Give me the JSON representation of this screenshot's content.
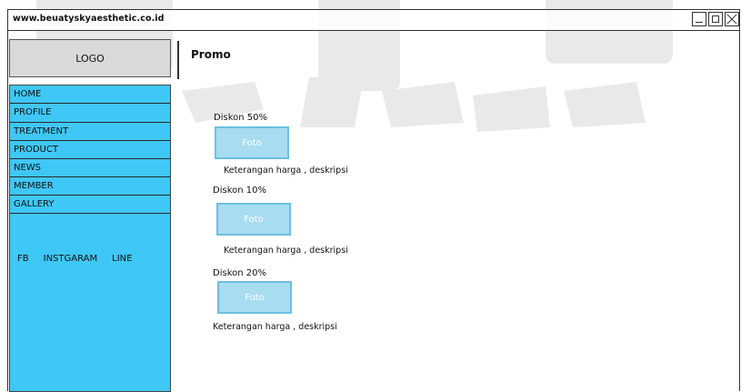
{
  "window": {
    "url": "www.beuatyskyaesthetic.co.id",
    "controls": [
      "minimize",
      "maximize",
      "close"
    ]
  },
  "logo": {
    "label": "LOGO"
  },
  "page": {
    "title": "Promo"
  },
  "sidebar": {
    "items": [
      {
        "label": "HOME"
      },
      {
        "label": "PROFILE"
      },
      {
        "label": "TREATMENT"
      },
      {
        "label": "PRODUCT"
      },
      {
        "label": "NEWS"
      },
      {
        "label": "MEMBER"
      },
      {
        "label": "GALLERY"
      }
    ],
    "social": [
      "FB",
      "INSTGARAM",
      "LINE"
    ]
  },
  "promos": [
    {
      "title": "Diskon 50%",
      "photo_label": "Foto",
      "description": "Keterangan harga , deskripsi"
    },
    {
      "title": "Diskon 10%",
      "photo_label": "Foto",
      "description": "Keterangan harga , deskripsi"
    },
    {
      "title": "Diskon 20%",
      "photo_label": "Foto",
      "description": "Keterangan harga , deskripsi"
    }
  ],
  "colors": {
    "sidebar": "#3fc7f5",
    "photo_fill": "#a8dcf1",
    "photo_border": "#6cbfe2",
    "logo_bg": "#d9d9d9"
  }
}
